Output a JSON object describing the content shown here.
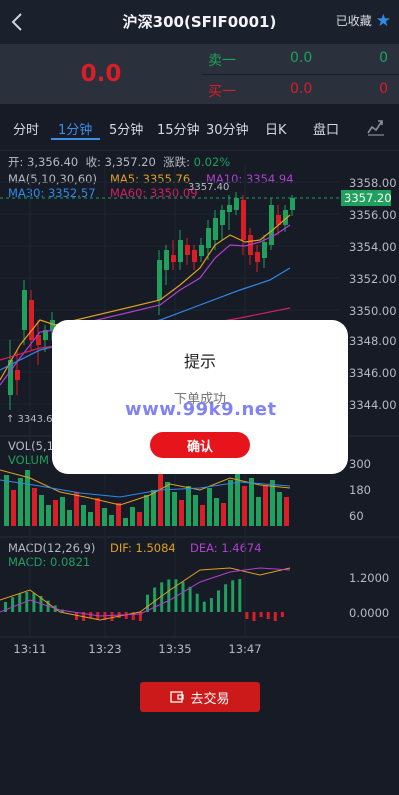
{
  "header": {
    "title": "沪深300(SFIF0001)",
    "favorite_label": "已收藏"
  },
  "quote": {
    "last_price": "0.0",
    "sell": {
      "label": "卖一",
      "price": "0.0",
      "volume": "0"
    },
    "buy": {
      "label": "买一",
      "price": "0.0",
      "volume": "0"
    }
  },
  "tabs": [
    {
      "label": "分时"
    },
    {
      "label": "1分钟",
      "active": true
    },
    {
      "label": "5分钟"
    },
    {
      "label": "15分钟"
    },
    {
      "label": "30分钟"
    },
    {
      "label": "日K"
    },
    {
      "label": "盘口"
    }
  ],
  "ohlc": {
    "open_label": "开:",
    "open": "3,356.40",
    "close_label": "收:",
    "close": "3,357.20",
    "change_label": "涨跌:",
    "change": "0.02%"
  },
  "ma": {
    "title": "MA(5,10,30,60)",
    "ma5": "MA5: 3355.76",
    "ma10": "MA10: 3354.94",
    "ma30": "MA30: 3352.57",
    "ma60": "MA60: 3350.09"
  },
  "volume_panel": {
    "title_partial": "VOL(5,1",
    "sub_partial": "VOLUM"
  },
  "macd": {
    "title": "MACD(12,26,9)",
    "dif": "DIF: 1.5084",
    "dea": "DEA: 1.4674",
    "macd": "MACD: 0.0821"
  },
  "chart_data": [
    {
      "type": "candlestick",
      "yticks": [
        "3358.00",
        "3356.00",
        "3354.00",
        "3352.00",
        "3350.00",
        "3348.00",
        "3346.00",
        "3344.00"
      ],
      "ylim": [
        3343.0,
        3358.8
      ],
      "current_price_label": "3357.20",
      "high_label": "3357.40",
      "low_label": "3343.60",
      "xticks": [
        "13:11",
        "13:23",
        "13:35",
        "13:47"
      ]
    },
    {
      "type": "bar",
      "yticks": [
        "300",
        "180",
        "60"
      ]
    },
    {
      "type": "bar",
      "yticks": [
        "1.2000",
        "0.0000"
      ]
    }
  ],
  "modal": {
    "title": "提示",
    "message": "下单成功",
    "confirm_label": "确认"
  },
  "watermark": "www.99k9.net",
  "trade_button_label": "去交易",
  "colors": {
    "up": "#1fa05c",
    "down": "#d91e28",
    "accent": "#3d8ee6",
    "ma5": "#e0a020",
    "ma10": "#b040d0",
    "ma30": "#2f8bea",
    "ma60": "#d02060"
  }
}
